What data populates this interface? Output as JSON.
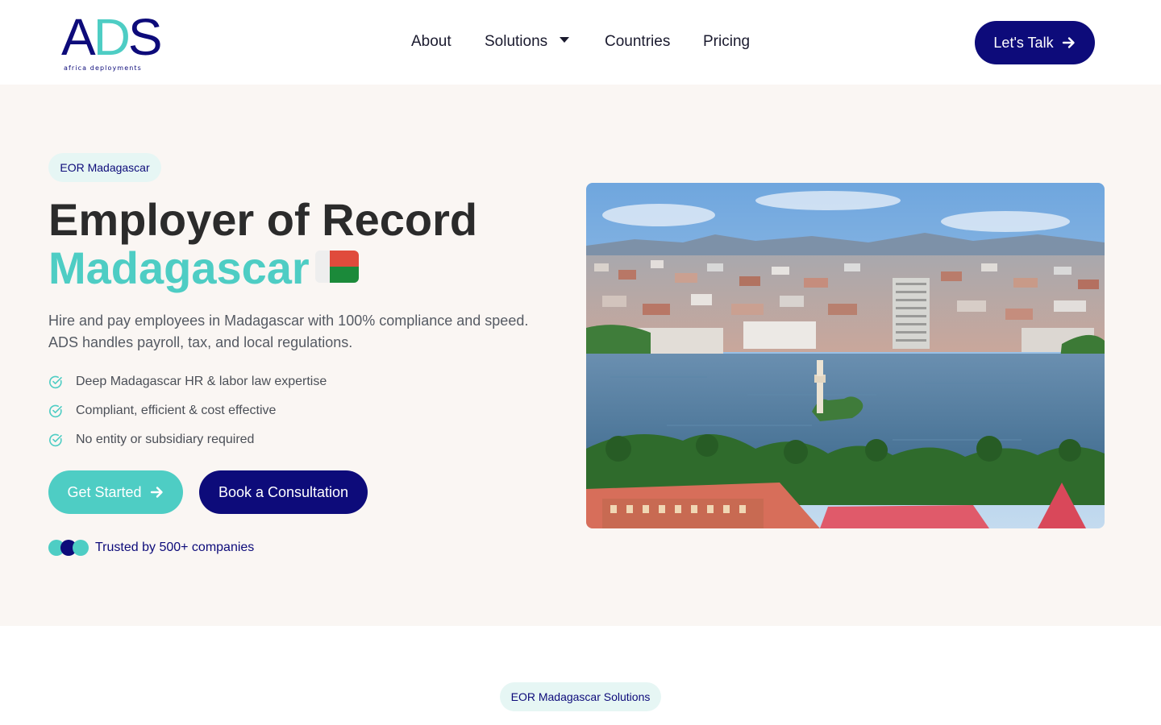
{
  "brand": {
    "logo_text_a": "A",
    "logo_text_d": "D",
    "logo_text_s": "S",
    "tagline": "africa deployments",
    "colors": {
      "navy": "#0d0b7a",
      "teal": "#4ecdc4",
      "hero_bg": "#faf6f3"
    }
  },
  "nav": {
    "about": "About",
    "solutions": "Solutions",
    "countries": "Countries",
    "pricing": "Pricing",
    "cta": "Let's Talk",
    "cta_icon": "arrow-right-icon"
  },
  "hero": {
    "pill": "EOR Madagascar",
    "title_line1": "Employer of Record",
    "title_line2": "Madagascar",
    "flag_icon": "madagascar-flag-icon",
    "description": "Hire and pay employees in Madagascar with 100% compliance and speed. ADS handles payroll, tax, and local regulations.",
    "features": [
      "Deep Madagascar HR & labor law expertise",
      "Compliant, efficient & cost effective",
      "No entity or subsidiary required"
    ],
    "primary_button": "Get Started",
    "secondary_button": "Book a Consultation",
    "trust_text": "Trusted by 500+ companies",
    "image_alt": "Antananarivo cityscape with Lake Anosy"
  },
  "solutions_section": {
    "pill": "EOR Madagascar Solutions"
  }
}
